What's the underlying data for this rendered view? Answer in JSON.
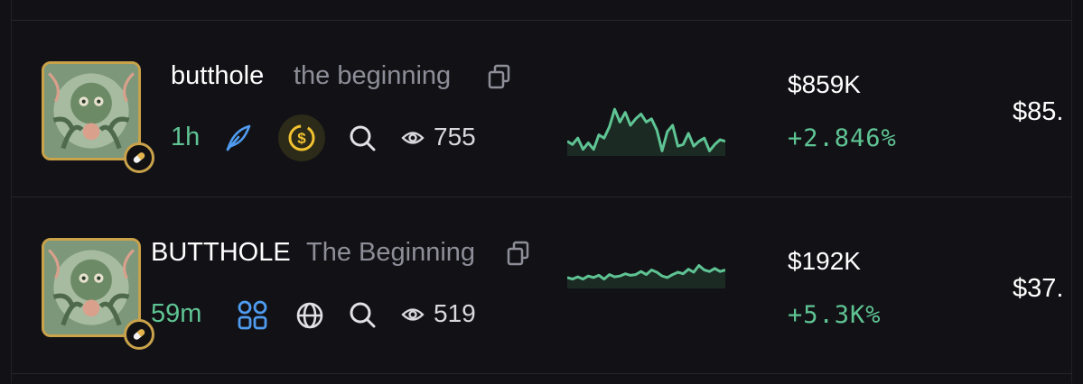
{
  "tokens": [
    {
      "symbol": "butthole",
      "name": "the beginning",
      "age": "1h",
      "platform_icon": "feather-icon",
      "extra_icon": "dollar-coin-icon",
      "views": "755",
      "market_cap": "$859K",
      "change": "+2.846%",
      "volume": "$85.",
      "sparkline": [
        42,
        44,
        40,
        47,
        43,
        47,
        38,
        40,
        33,
        22,
        30,
        24,
        32,
        28,
        25,
        30,
        28,
        35,
        48,
        36,
        32,
        45,
        44,
        37,
        45,
        42,
        40,
        48,
        44,
        41,
        42
      ]
    },
    {
      "symbol": "BUTTHOLE",
      "name": "The Beginning",
      "age": "59m",
      "platform_icon": "grid-icon",
      "extra_icon": "globe-icon",
      "views": "519",
      "market_cap": "$192K",
      "change": "+5.3K%",
      "volume": "$37.",
      "sparkline": [
        38,
        40,
        37,
        40,
        36,
        38,
        35,
        40,
        34,
        37,
        36,
        33,
        35,
        34,
        30,
        34,
        28,
        31,
        36,
        38,
        34,
        31,
        33,
        27,
        31,
        22,
        28,
        30,
        26,
        30,
        28
      ]
    }
  ],
  "colors": {
    "accent_green": "#5fc494",
    "gold_border": "#c9a24a",
    "muted_text": "#8e8e99"
  }
}
